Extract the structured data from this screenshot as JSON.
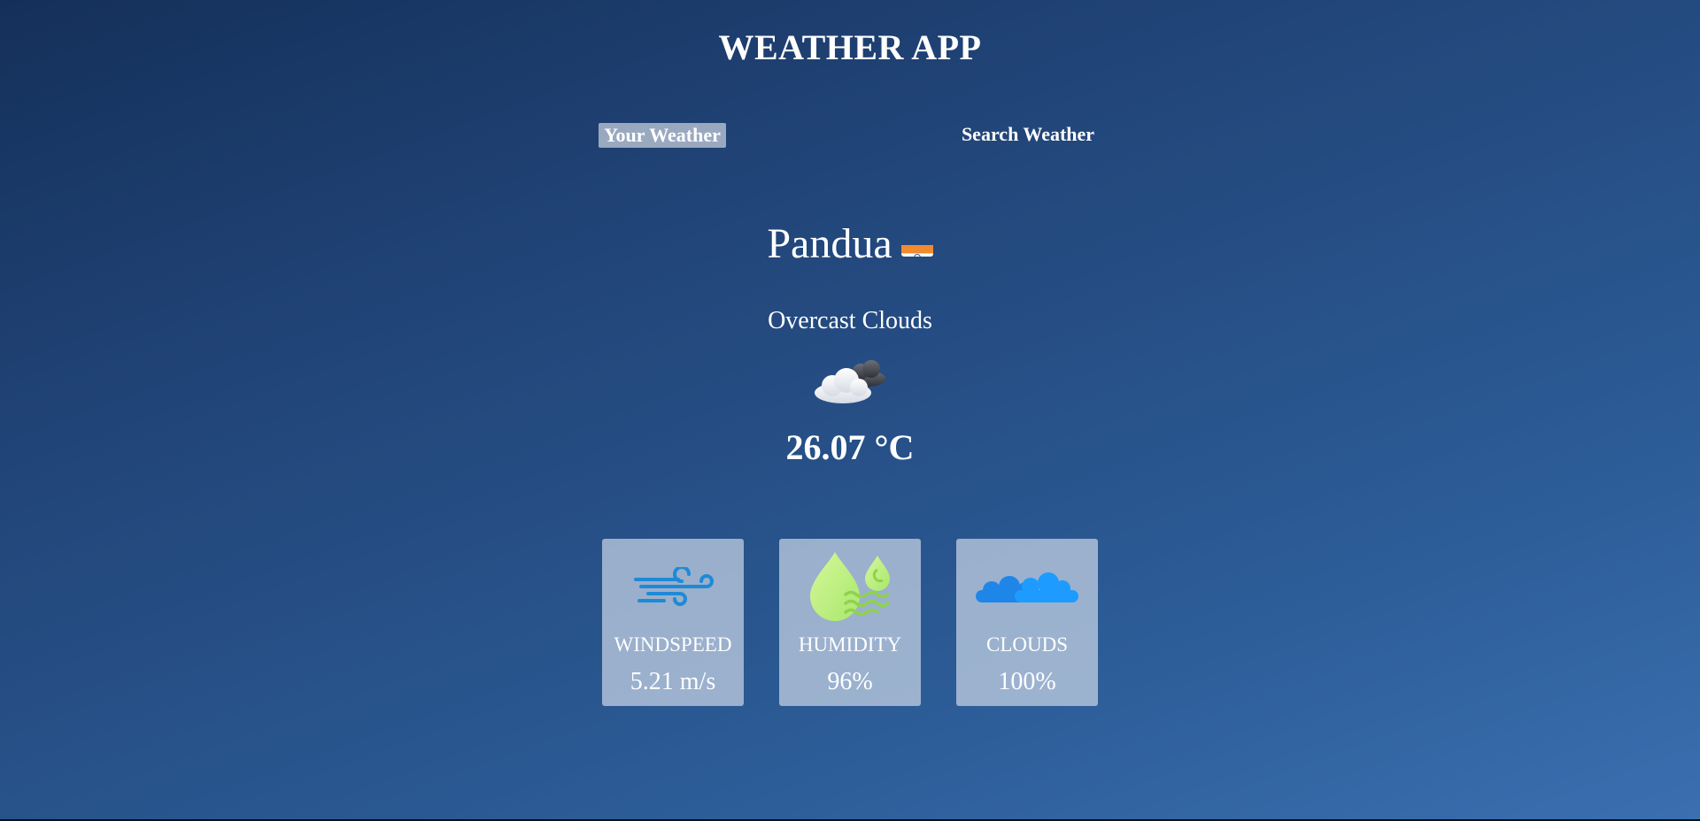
{
  "header": {
    "title": "WEATHER APP"
  },
  "tabs": [
    {
      "label": "Your Weather",
      "active": true
    },
    {
      "label": "Search Weather",
      "active": false
    }
  ],
  "weather": {
    "city": "Pandua",
    "flag_icon": "india-flag-icon",
    "description": "Overcast Clouds",
    "condition_icon": "overcast-clouds-icon",
    "temperature": "26.07 °C"
  },
  "stats": [
    {
      "label": "WINDSPEED",
      "value": "5.21 m/s",
      "icon": "wind-icon"
    },
    {
      "label": "HUMIDITY",
      "value": "96%",
      "icon": "humidity-icon"
    },
    {
      "label": "CLOUDS",
      "value": "100%",
      "icon": "clouds-icon"
    }
  ],
  "colors": {
    "background_start": "#14305a",
    "background_end": "#3a6fb0",
    "wind_icon": "#1e8ad6",
    "humidity_icon": "#c8f08a",
    "clouds_icon": "#1e90ff"
  }
}
